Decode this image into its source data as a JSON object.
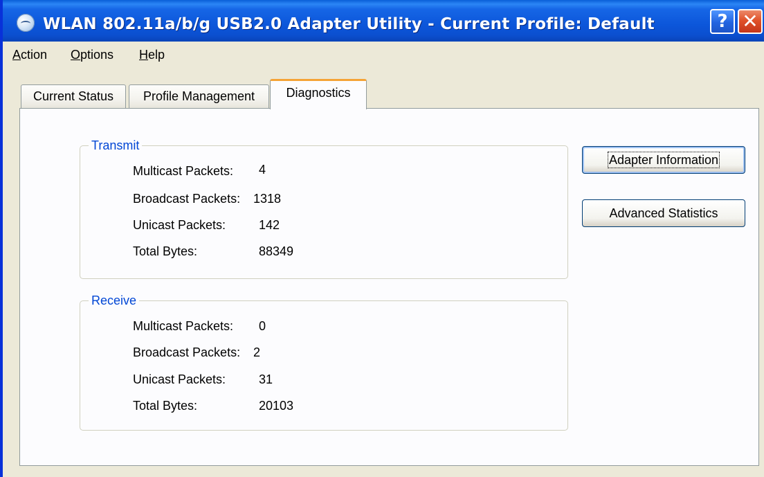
{
  "window": {
    "title": "WLAN 802.11a/b/g USB2.0 Adapter Utility - Current Profile: Default",
    "help_label": "?",
    "close_label": "✕"
  },
  "menu": {
    "items": [
      {
        "first": "A",
        "rest": "ction"
      },
      {
        "first": "O",
        "rest": "ptions"
      },
      {
        "first": "H",
        "rest": "elp"
      }
    ]
  },
  "tabs": [
    {
      "label": "Current Status"
    },
    {
      "label": "Profile Management"
    },
    {
      "label": "Diagnostics"
    }
  ],
  "active_tab": "Diagnostics",
  "transmit": {
    "title": "Transmit",
    "rows": [
      {
        "label": "Multicast Packets:",
        "value": "4"
      },
      {
        "label": "Broadcast Packets:",
        "value": "1318"
      },
      {
        "label": "Unicast Packets:",
        "value": "142"
      },
      {
        "label": "Total Bytes:",
        "value": "88349"
      }
    ]
  },
  "receive": {
    "title": "Receive",
    "rows": [
      {
        "label": "Multicast Packets:",
        "value": "0"
      },
      {
        "label": "Broadcast Packets:",
        "value": "2"
      },
      {
        "label": "Unicast Packets:",
        "value": "31"
      },
      {
        "label": "Total Bytes:",
        "value": "20103"
      }
    ]
  },
  "buttons": {
    "adapter_info": "Adapter Information",
    "advanced_stats": "Advanced Statistics"
  },
  "colors": {
    "titlebar": "#0b4fcf",
    "group_title": "#0046d5",
    "active_tab_accent": "#f5a336"
  }
}
